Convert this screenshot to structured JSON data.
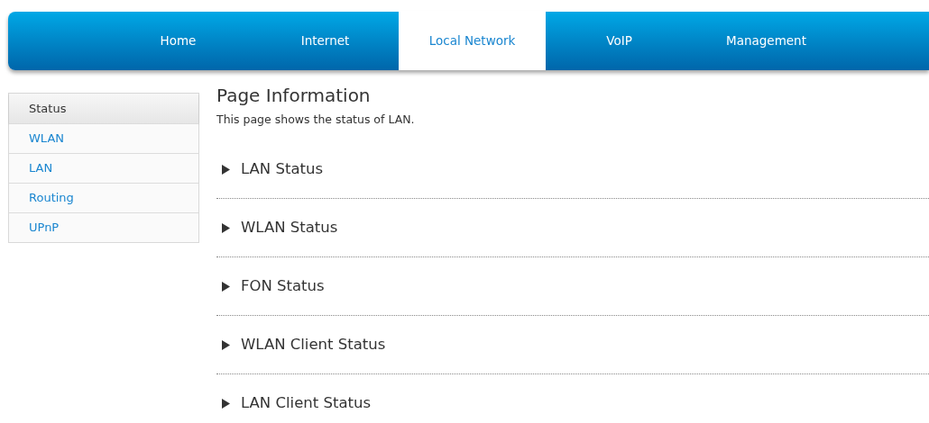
{
  "nav_tabs": [
    {
      "label": "Home",
      "selected": false
    },
    {
      "label": "Internet",
      "selected": false
    },
    {
      "label": "Local Network",
      "selected": true
    },
    {
      "label": "VoIP",
      "selected": false
    },
    {
      "label": "Management",
      "selected": false
    }
  ],
  "sidebar": {
    "items": [
      {
        "label": "Status",
        "selected": true
      },
      {
        "label": "WLAN",
        "selected": false
      },
      {
        "label": "LAN",
        "selected": false
      },
      {
        "label": "Routing",
        "selected": false
      },
      {
        "label": "UPnP",
        "selected": false
      }
    ]
  },
  "page": {
    "title": "Page Information",
    "description": "This page shows the status of LAN.",
    "sections": [
      {
        "label": "LAN Status",
        "expanded": false
      },
      {
        "label": "WLAN Status",
        "expanded": false
      },
      {
        "label": "FON Status",
        "expanded": false
      },
      {
        "label": "WLAN Client Status",
        "expanded": false
      },
      {
        "label": "LAN Client Status",
        "expanded": false
      }
    ]
  }
}
